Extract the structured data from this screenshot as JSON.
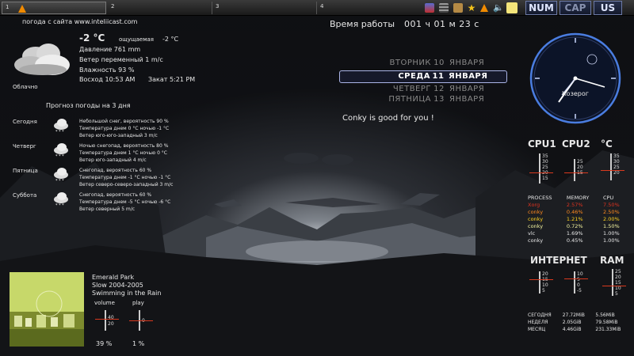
{
  "top_panel": {
    "workspaces": [
      {
        "label": "1",
        "active": true
      },
      {
        "label": "2",
        "active": false
      },
      {
        "label": "3",
        "active": false
      },
      {
        "label": "4",
        "active": false
      }
    ],
    "tray_icons": [
      "network-icon",
      "stack-icon",
      "package-icon",
      "star-icon",
      "vlc-icon",
      "volume-icon",
      "notes-icon"
    ],
    "indicators": {
      "num": "NUM",
      "cap": "CAP",
      "layout": "US"
    }
  },
  "weather": {
    "source": "погода с сайта www.inteliicast.com",
    "temp": "-2 °C",
    "feels_label": "ощущаемая",
    "feels_value": "-2 °C",
    "pressure": "Давление  761 mm",
    "wind": "Ветер  переменный  1 m/c",
    "humidity": "Влажность  93 %",
    "sunrise": "Восход 10:53 AM",
    "sunset": "Закат 5:21 PM",
    "condition": "Облачно",
    "forecast_title": "Прогноз погоды на 3 дня",
    "forecast": [
      {
        "day": "Сегодня",
        "l1": "Небольшой снег,  вероятность 90 %",
        "l2": "Температура днем  0 °C   ночью  -1 °C",
        "l3": "Ветер юго-юго-западный   3 m/c"
      },
      {
        "day": "Четверг",
        "l1": "Ночью снегопад,  вероятность 80 %",
        "l2": "Температура днем  1 °C   ночью  0 °C",
        "l3": "Ветер юго-западный   4 m/c"
      },
      {
        "day": "Пятница",
        "l1": "Снегопад,  вероятность 60 %",
        "l2": "Температура днем  -1 °C   ночью  -1 °C",
        "l3": "Ветер северо-северо-западный   3 m/c"
      },
      {
        "day": "Суббота",
        "l1": "Снегопад,  вероятность 60 %",
        "l2": "Температура днем  -5 °C   ночью  -6 °C",
        "l3": "Ветер северный   5 m/c"
      }
    ]
  },
  "uptime": {
    "label": "Время работы",
    "value": "001 ч  01 м  23 с"
  },
  "calendar": [
    {
      "name": "ВТОРНИК",
      "num": "10",
      "month": "ЯНВАРЯ",
      "current": false
    },
    {
      "name": "СРЕДА",
      "num": "11",
      "month": "ЯНВАРЯ",
      "current": true
    },
    {
      "name": "ЧЕТВЕРГ",
      "num": "12",
      "month": "ЯНВАРЯ",
      "current": false
    },
    {
      "name": "ПЯТНИЦА",
      "num": "13",
      "month": "ЯНВАРЯ",
      "current": false
    }
  ],
  "conky_message": "Conky is good for you !",
  "clock": {
    "sign": "Козерог"
  },
  "cpu": {
    "headers": [
      "CPU1",
      "CPU2",
      "°C"
    ],
    "gauges": [
      {
        "ticks": [
          "35",
          "30",
          "25",
          "20",
          "15"
        ],
        "value": "20"
      },
      {
        "ticks": [
          "25",
          "20",
          "15"
        ],
        "value": "15"
      },
      {
        "ticks": [
          "35",
          "30",
          "25",
          "20"
        ],
        "value": "25"
      }
    ]
  },
  "processes": {
    "headers": [
      "PROCESS",
      "MEMORY",
      "CPU"
    ],
    "rows": [
      {
        "name": "Xorg",
        "mem": "2.57%",
        "cpu": "7.50%",
        "color": "#e0331f"
      },
      {
        "name": "conky",
        "mem": "0.46%",
        "cpu": "2.50%",
        "color": "#ff8a1f"
      },
      {
        "name": "conky",
        "mem": "1.21%",
        "cpu": "2.00%",
        "color": "#ffd21f"
      },
      {
        "name": "conky",
        "mem": "0.72%",
        "cpu": "1.50%",
        "color": "#f4f4a0"
      },
      {
        "name": "vlc",
        "mem": "1.69%",
        "cpu": "1.00%",
        "color": "#e8e8e8"
      },
      {
        "name": "conky",
        "mem": "0.45%",
        "cpu": "1.00%",
        "color": "#e8e8e8"
      }
    ]
  },
  "network": {
    "internet_label": "ИНТЕРНЕТ",
    "ram_label": "RAM",
    "gauges": [
      {
        "ticks": [
          "20",
          "15",
          "10",
          "5"
        ],
        "value": "15"
      },
      {
        "ticks": [
          "10",
          "5",
          "0",
          "-5"
        ],
        "value": "5"
      },
      {
        "ticks": [
          "25",
          "20",
          "15",
          "10",
          "5"
        ],
        "value": "15"
      }
    ],
    "stats": [
      {
        "label": "СЕГОДНЯ",
        "down": "27.72MiB",
        "up": "5.56MiB"
      },
      {
        "label": "НЕДЕЛЯ",
        "down": "2.05GiB",
        "up": "79.58MiB"
      },
      {
        "label": "МЕСЯЦ",
        "down": "4.46GiB",
        "up": "231.33MiB"
      }
    ]
  },
  "player": {
    "artist": "Emerald Park",
    "album": "Slow 2004-2005",
    "track": "Swimming in the Rain",
    "volume_label": "volume",
    "play_label": "play",
    "volume_ticks": [
      "40",
      "20"
    ],
    "play_ticks": [
      "0"
    ],
    "volume_value": "39 %",
    "play_value": "1 %"
  }
}
